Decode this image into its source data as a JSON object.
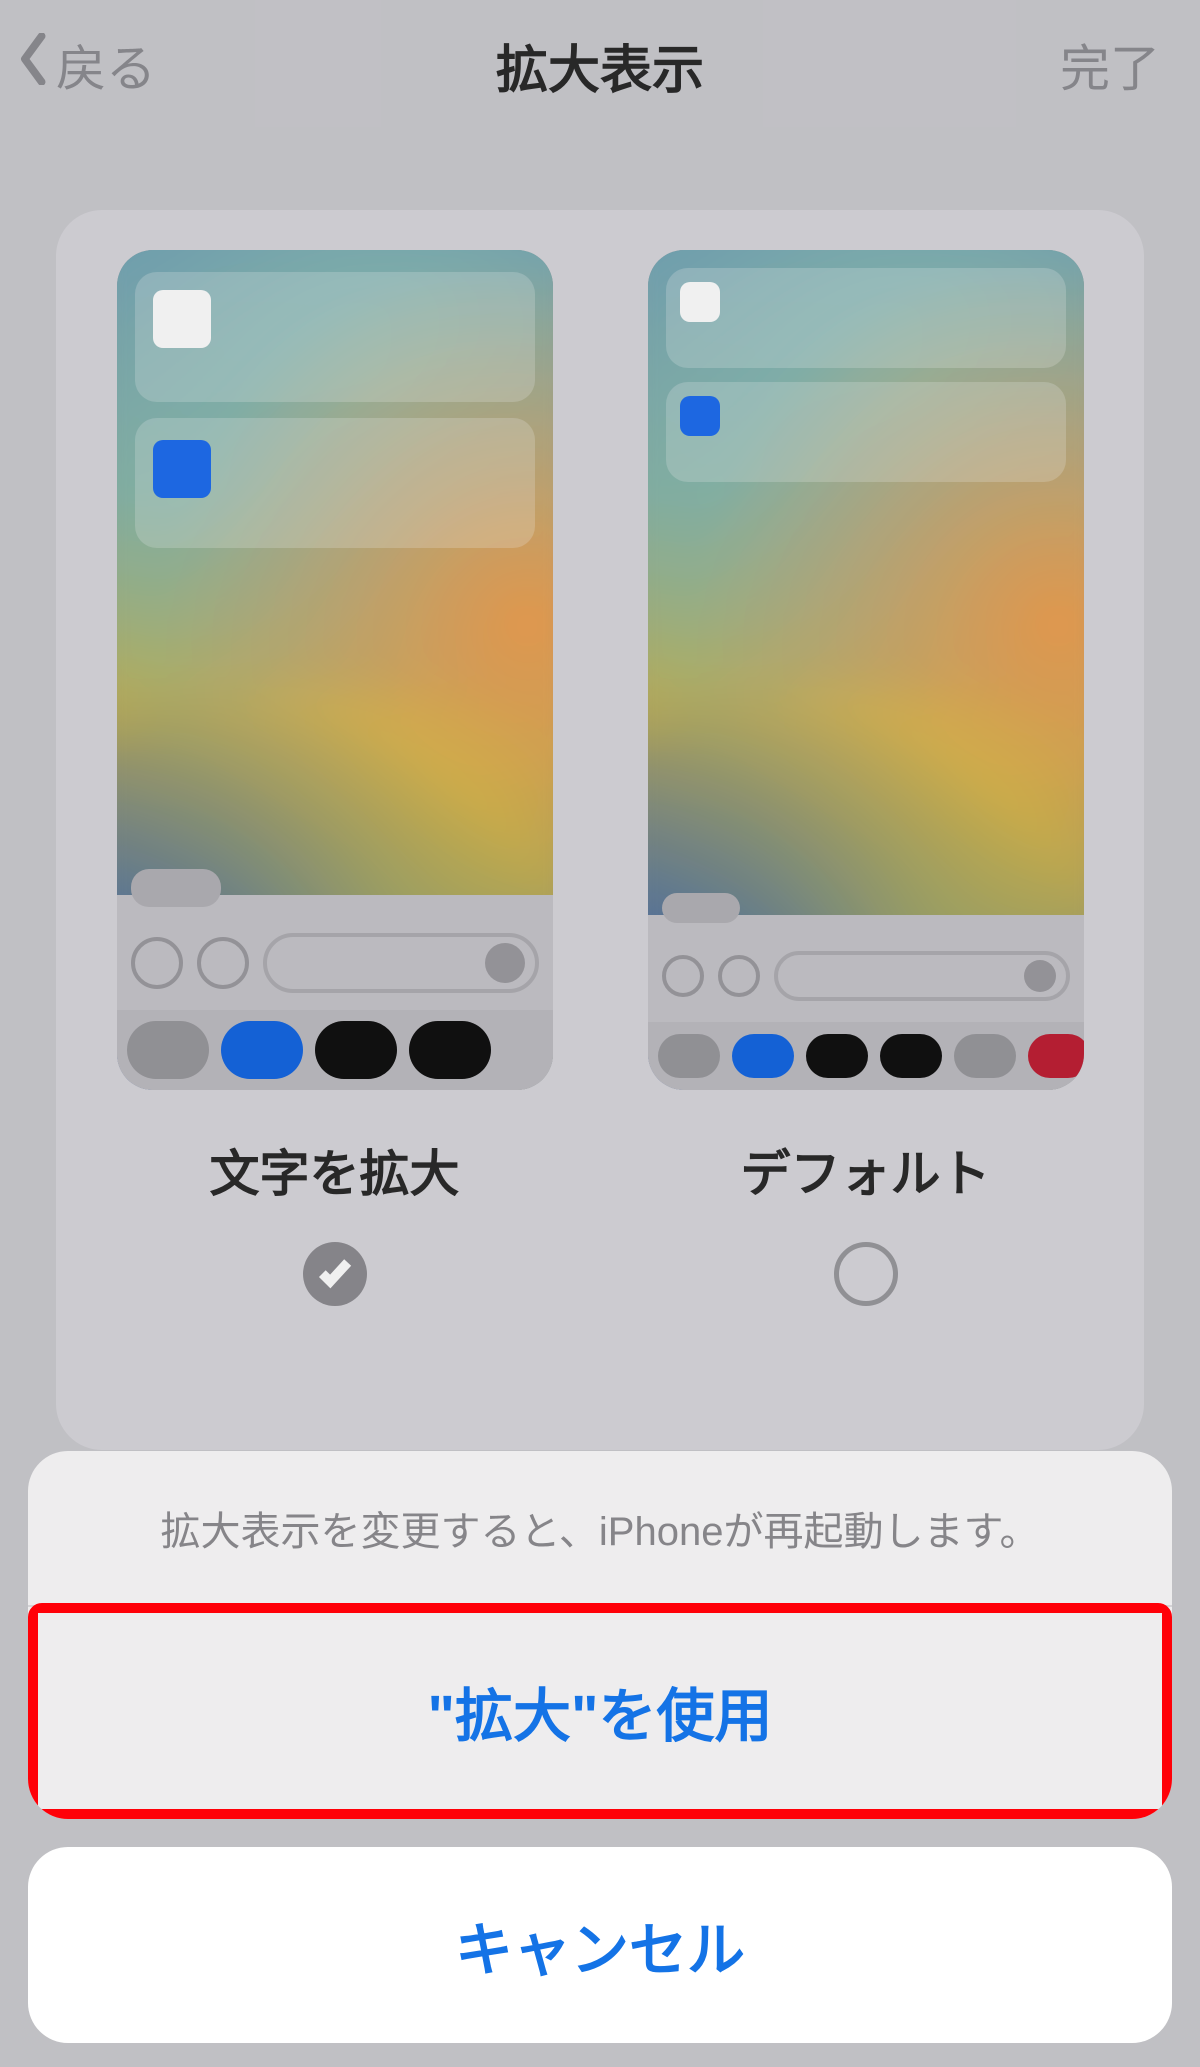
{
  "nav": {
    "back": "戻る",
    "title": "拡大表示",
    "done": "完了"
  },
  "options": {
    "zoomed": {
      "label": "文字を拡大",
      "selected": true
    },
    "default": {
      "label": "デフォルト",
      "selected": false
    }
  },
  "sheet": {
    "message": "拡大表示を変更すると、iPhoneが再起動します。",
    "confirm": "\"拡大\"を使用",
    "cancel": "キャンセル"
  },
  "colors": {
    "accent": "#1473e6",
    "highlight": "#ff0008"
  }
}
